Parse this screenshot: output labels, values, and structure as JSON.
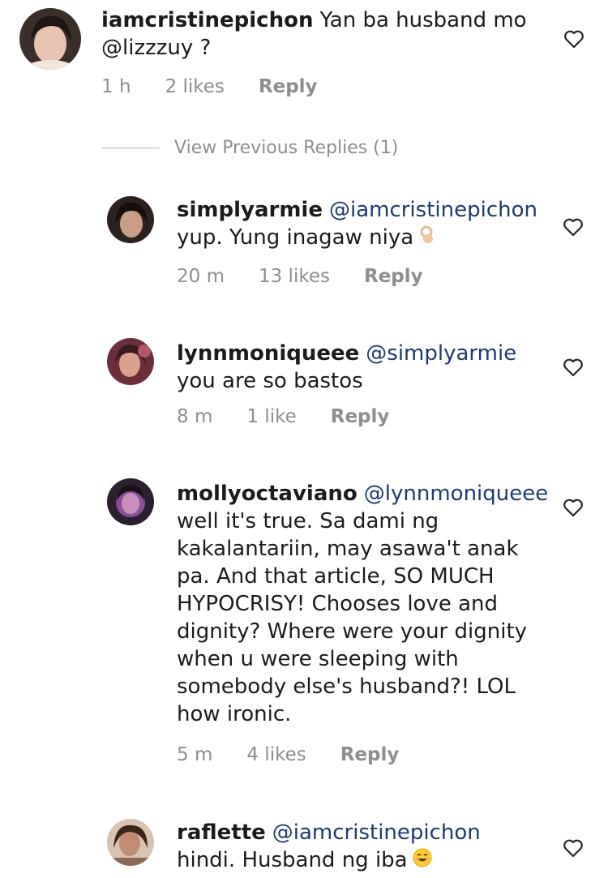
{
  "comments": [
    {
      "username": "iamcristinepichon",
      "mention": "",
      "text": "Yan ba husband mo @lizzzuy ?",
      "time": "1 h",
      "likes": "2 likes",
      "reply": "Reply"
    },
    {
      "username": "simplyarmie",
      "mention": "@iamcristinepichon",
      "text": "yup. Yung inagaw niya",
      "emoji": "ok-hand-emoji",
      "time": "20 m",
      "likes": "13 likes",
      "reply": "Reply"
    },
    {
      "username": "lynnmoniqueee",
      "mention": "@simplyarmie",
      "text": "you are so bastos",
      "time": "8 m",
      "likes": "1 like",
      "reply": "Reply"
    },
    {
      "username": "mollyoctaviano",
      "mention": "@lynnmoniqueee",
      "text": "well it's true. Sa dami ng kakalantariin, may asawa't anak pa. And that article, SO MUCH HYPOCRISY! Chooses love and dignity? Where were your dignity when u were sleeping with somebody else's husband?! LOL how ironic.",
      "time": "5 m",
      "likes": "4 likes",
      "reply": "Reply"
    },
    {
      "username": "raflette",
      "mention": "@iamcristinepichon",
      "text": "hindi. Husband ng iba",
      "emoji": "smiling-face-emoji",
      "time": "",
      "likes": "",
      "reply": ""
    }
  ],
  "view_previous_replies": "View Previous Replies (1)",
  "icons": {
    "like": "heart-outline-icon"
  },
  "colors": {
    "text": "#1b1b1b",
    "muted": "#8e8e8e",
    "mention": "#1d3b6e"
  }
}
